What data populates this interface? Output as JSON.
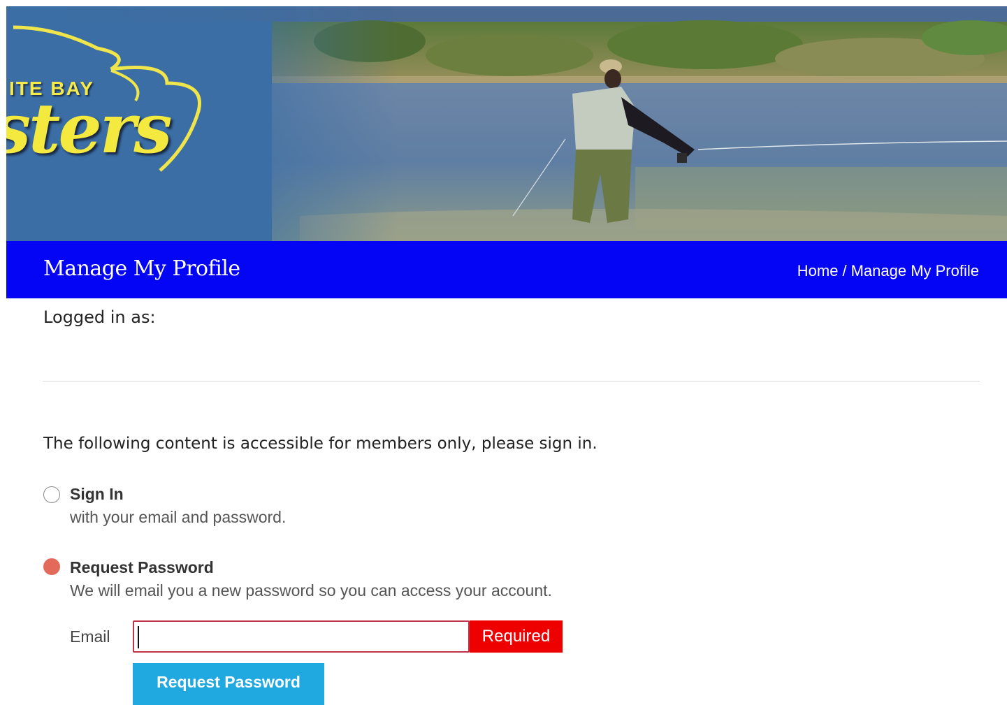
{
  "banner": {
    "logo_line1": "ITE BAY",
    "logo_line2": "sters"
  },
  "title_bar": {
    "title": "Manage My Profile",
    "breadcrumb": {
      "home": "Home",
      "separator": "/",
      "current": "Manage My Profile"
    }
  },
  "account": {
    "logged_in_label": "Logged in as:"
  },
  "members_message": "The following content is accessible for members only, please sign in.",
  "options": {
    "sign_in": {
      "title": "Sign In",
      "description": "with your email and password.",
      "selected": false
    },
    "request_password": {
      "title": "Request Password",
      "description": "We will email you a new password so you can access your account.",
      "selected": true
    }
  },
  "form": {
    "email_label": "Email",
    "email_value": "",
    "required_label": "Required",
    "submit_label": "Request Password"
  },
  "colors": {
    "title_bar": "#0505f5",
    "button": "#20a9e1",
    "required": "#ee0000",
    "radio_selected": "#e3695a"
  }
}
